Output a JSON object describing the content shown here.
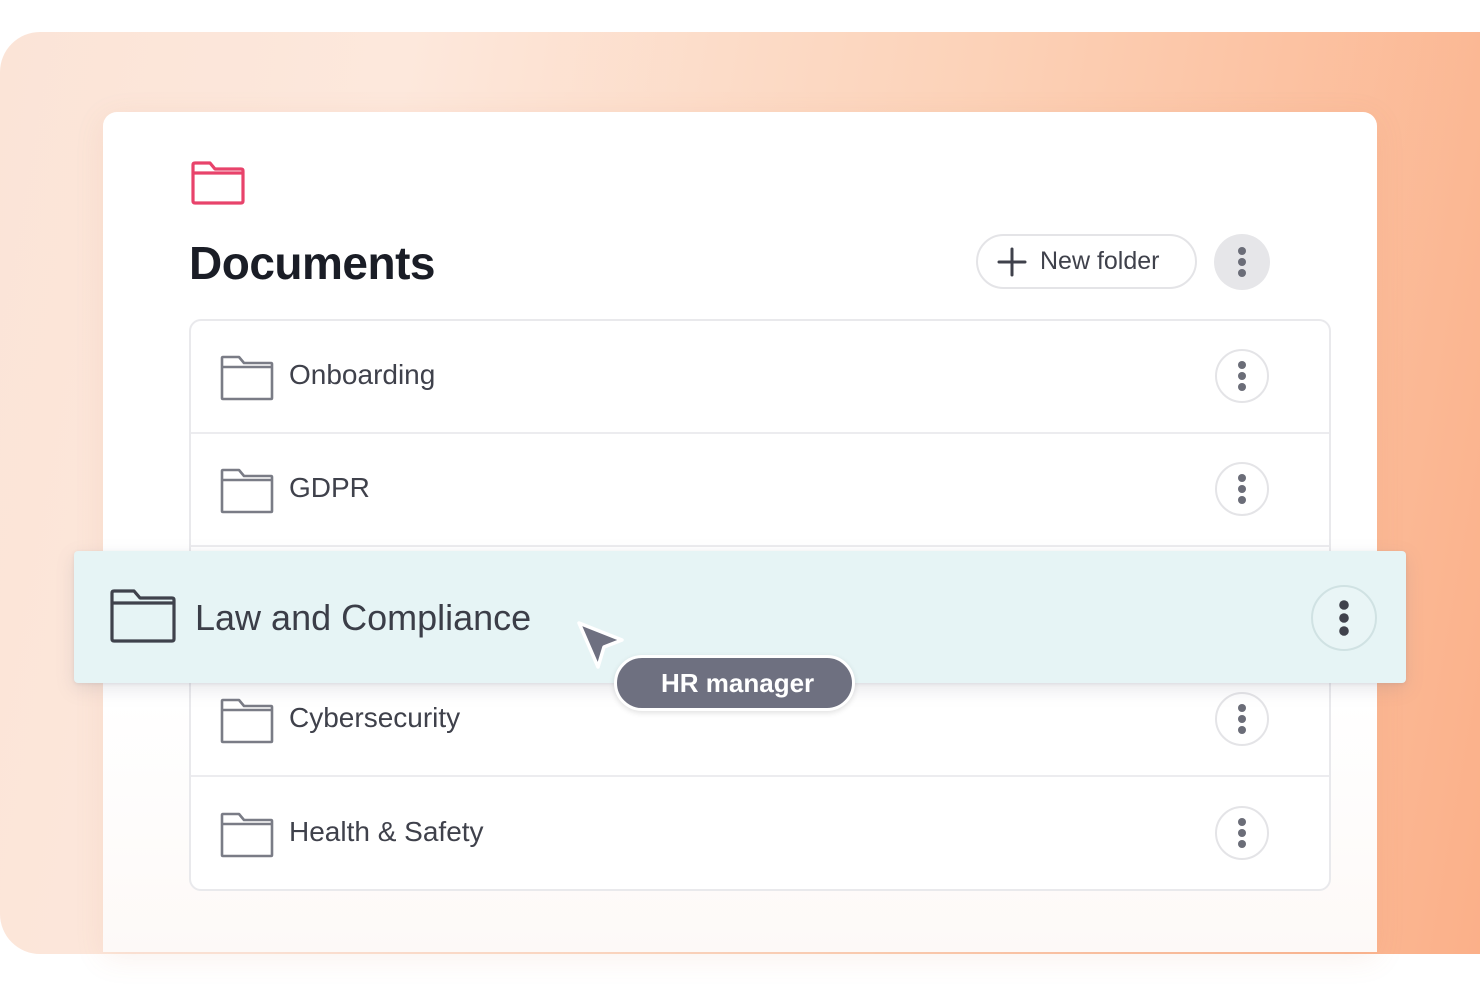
{
  "header": {
    "title": "Documents",
    "brand_icon": "folder-icon",
    "brand_color": "#e8436b"
  },
  "toolbar": {
    "new_folder_label": "New folder",
    "new_folder_icon": "plus-icon",
    "menu_icon": "more-vertical-icon"
  },
  "folders": [
    {
      "label": "Onboarding",
      "icon": "folder-icon"
    },
    {
      "label": "GDPR",
      "icon": "folder-icon"
    },
    {
      "label": "Cybersecurity",
      "icon": "folder-icon"
    },
    {
      "label": "Health & Safety",
      "icon": "folder-icon"
    }
  ],
  "dragged_folder": {
    "label": "Law and Compliance",
    "icon": "folder-icon",
    "highlight_color": "#e6f4f5"
  },
  "cursor": {
    "icon": "cursor-arrow-icon",
    "user_label": "HR manager"
  },
  "colors": {
    "accent": "#e8436b",
    "text": "#1a1d26",
    "muted_text": "#3f414b",
    "tag_background": "#6e7080"
  }
}
